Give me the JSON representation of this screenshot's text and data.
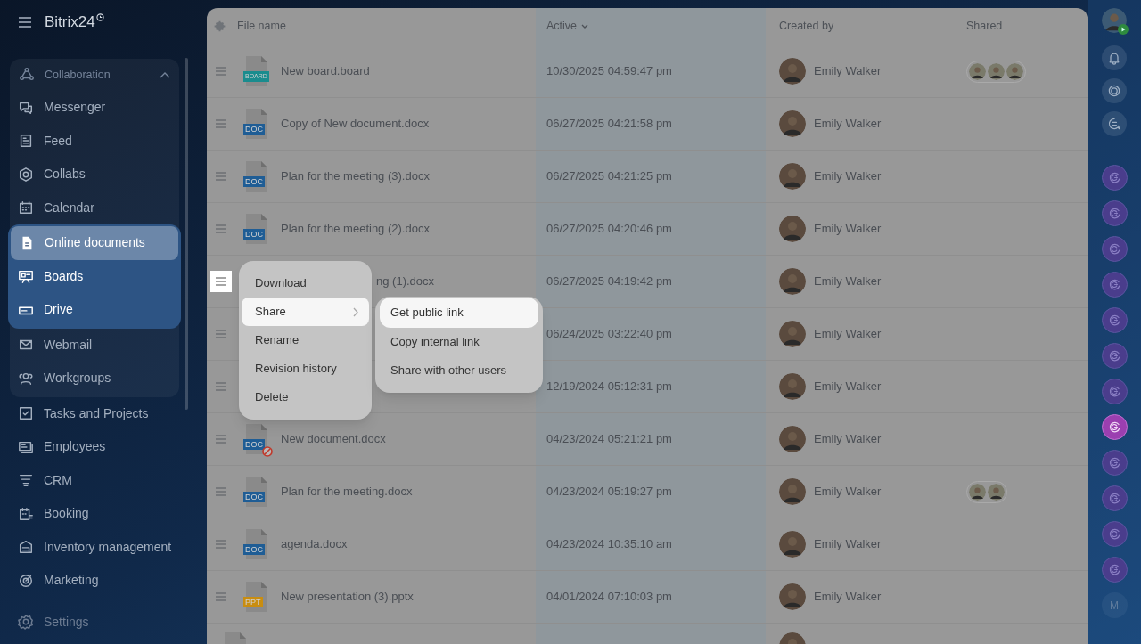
{
  "app": {
    "title": "Bitrix24"
  },
  "sidebar": {
    "group": {
      "label": "Collaboration",
      "expanded": true,
      "children": [
        {
          "label": "Messenger",
          "selected": false,
          "highlighted": false
        },
        {
          "label": "Feed",
          "selected": false,
          "highlighted": false
        },
        {
          "label": "Collabs",
          "selected": false,
          "highlighted": false
        },
        {
          "label": "Calendar",
          "selected": false,
          "highlighted": false
        },
        {
          "label": "Online documents",
          "selected": true,
          "highlighted": true
        },
        {
          "label": "Boards",
          "selected": false,
          "highlighted": true
        },
        {
          "label": "Drive",
          "selected": false,
          "highlighted": true
        },
        {
          "label": "Webmail",
          "selected": false,
          "highlighted": false
        },
        {
          "label": "Workgroups",
          "selected": false,
          "highlighted": false
        }
      ]
    },
    "items": [
      {
        "label": "Tasks and Projects",
        "selected": false
      },
      {
        "label": "Employees",
        "selected": false
      },
      {
        "label": "CRM",
        "selected": false
      },
      {
        "label": "Booking",
        "selected": false
      },
      {
        "label": "Inventory management",
        "selected": false
      },
      {
        "label": "Marketing",
        "selected": false
      }
    ],
    "settings": "Settings"
  },
  "table": {
    "columns": [
      {
        "label": "File name",
        "sorted": false
      },
      {
        "label": "Active",
        "sorted": true
      },
      {
        "label": "Created by",
        "sorted": false
      },
      {
        "label": "Shared",
        "sorted": false
      }
    ],
    "rows": [
      {
        "name": "New board.board",
        "kind": "board",
        "badge": "BOARD",
        "blocked": false,
        "active": "10/30/2025 04:59:47 pm",
        "created_by": "Emily Walker",
        "menu_open": false
      },
      {
        "name": "Copy of New document.docx",
        "kind": "doc",
        "badge": "DOC",
        "blocked": false,
        "active": "06/27/2025 04:21:58 pm",
        "created_by": "Emily Walker",
        "menu_open": false
      },
      {
        "name": "Plan for the meeting (3).docx",
        "kind": "doc",
        "badge": "DOC",
        "blocked": false,
        "active": "06/27/2025 04:21:25 pm",
        "created_by": "Emily Walker",
        "menu_open": false
      },
      {
        "name": "Plan for the meeting (2).docx",
        "kind": "doc",
        "badge": "DOC",
        "blocked": false,
        "active": "06/27/2025 04:20:46 pm",
        "created_by": "Emily Walker",
        "menu_open": false
      },
      {
        "name": "ng (1).docx",
        "kind": "hidden",
        "active": "06/27/2025 04:19:42 pm",
        "created_by": "Emily Walker",
        "menu_open": true
      },
      {
        "kind": "hidden",
        "active": "06/24/2025 03:22:40 pm",
        "created_by": "Emily Walker",
        "menu_open": false
      },
      {
        "kind": "hidden",
        "active": "12/19/2024 05:12:31 pm",
        "created_by": "Emily Walker",
        "menu_open": false
      },
      {
        "name": "New document.docx",
        "kind": "doc",
        "badge": "DOC",
        "blocked": true,
        "active": "04/23/2024 05:21:21 pm",
        "created_by": "Emily Walker",
        "menu_open": false
      },
      {
        "name": "Plan for the meeting.docx",
        "kind": "doc",
        "badge": "DOC",
        "blocked": false,
        "active": "04/23/2024 05:19:27 pm",
        "created_by": "Emily Walker",
        "menu_open": false
      },
      {
        "name": "agenda.docx",
        "kind": "doc",
        "badge": "DOC",
        "blocked": false,
        "active": "04/23/2024 10:35:10 am",
        "created_by": "Emily Walker",
        "menu_open": false
      },
      {
        "name": "New presentation (3).pptx",
        "kind": "ppt",
        "badge": "PPT",
        "blocked": false,
        "active": "04/01/2024 07:10:03 pm",
        "created_by": "Emily Walker",
        "menu_open": false
      },
      {
        "kind": "blank"
      }
    ]
  },
  "menu": {
    "items": [
      {
        "label": "Download",
        "selected": false,
        "submenu": false
      },
      {
        "label": "Share",
        "selected": true,
        "submenu": true
      },
      {
        "label": "Rename",
        "selected": false,
        "submenu": false
      },
      {
        "label": "Revision history",
        "selected": false,
        "submenu": false
      },
      {
        "label": "Delete",
        "selected": false,
        "submenu": false
      }
    ]
  },
  "submenu": {
    "items": [
      {
        "label": "Get public link",
        "selected": true
      },
      {
        "label": "Copy internal link",
        "selected": false
      },
      {
        "label": "Share with other users",
        "selected": false
      }
    ]
  },
  "rail": {
    "apps": [
      {
        "selected": false
      },
      {
        "selected": false
      },
      {
        "selected": false
      },
      {
        "selected": false
      },
      {
        "selected": false
      },
      {
        "selected": false
      },
      {
        "selected": false
      },
      {
        "selected": true
      },
      {
        "selected": false
      },
      {
        "selected": false
      },
      {
        "selected": false
      },
      {
        "selected": false
      }
    ],
    "initial": "M"
  }
}
